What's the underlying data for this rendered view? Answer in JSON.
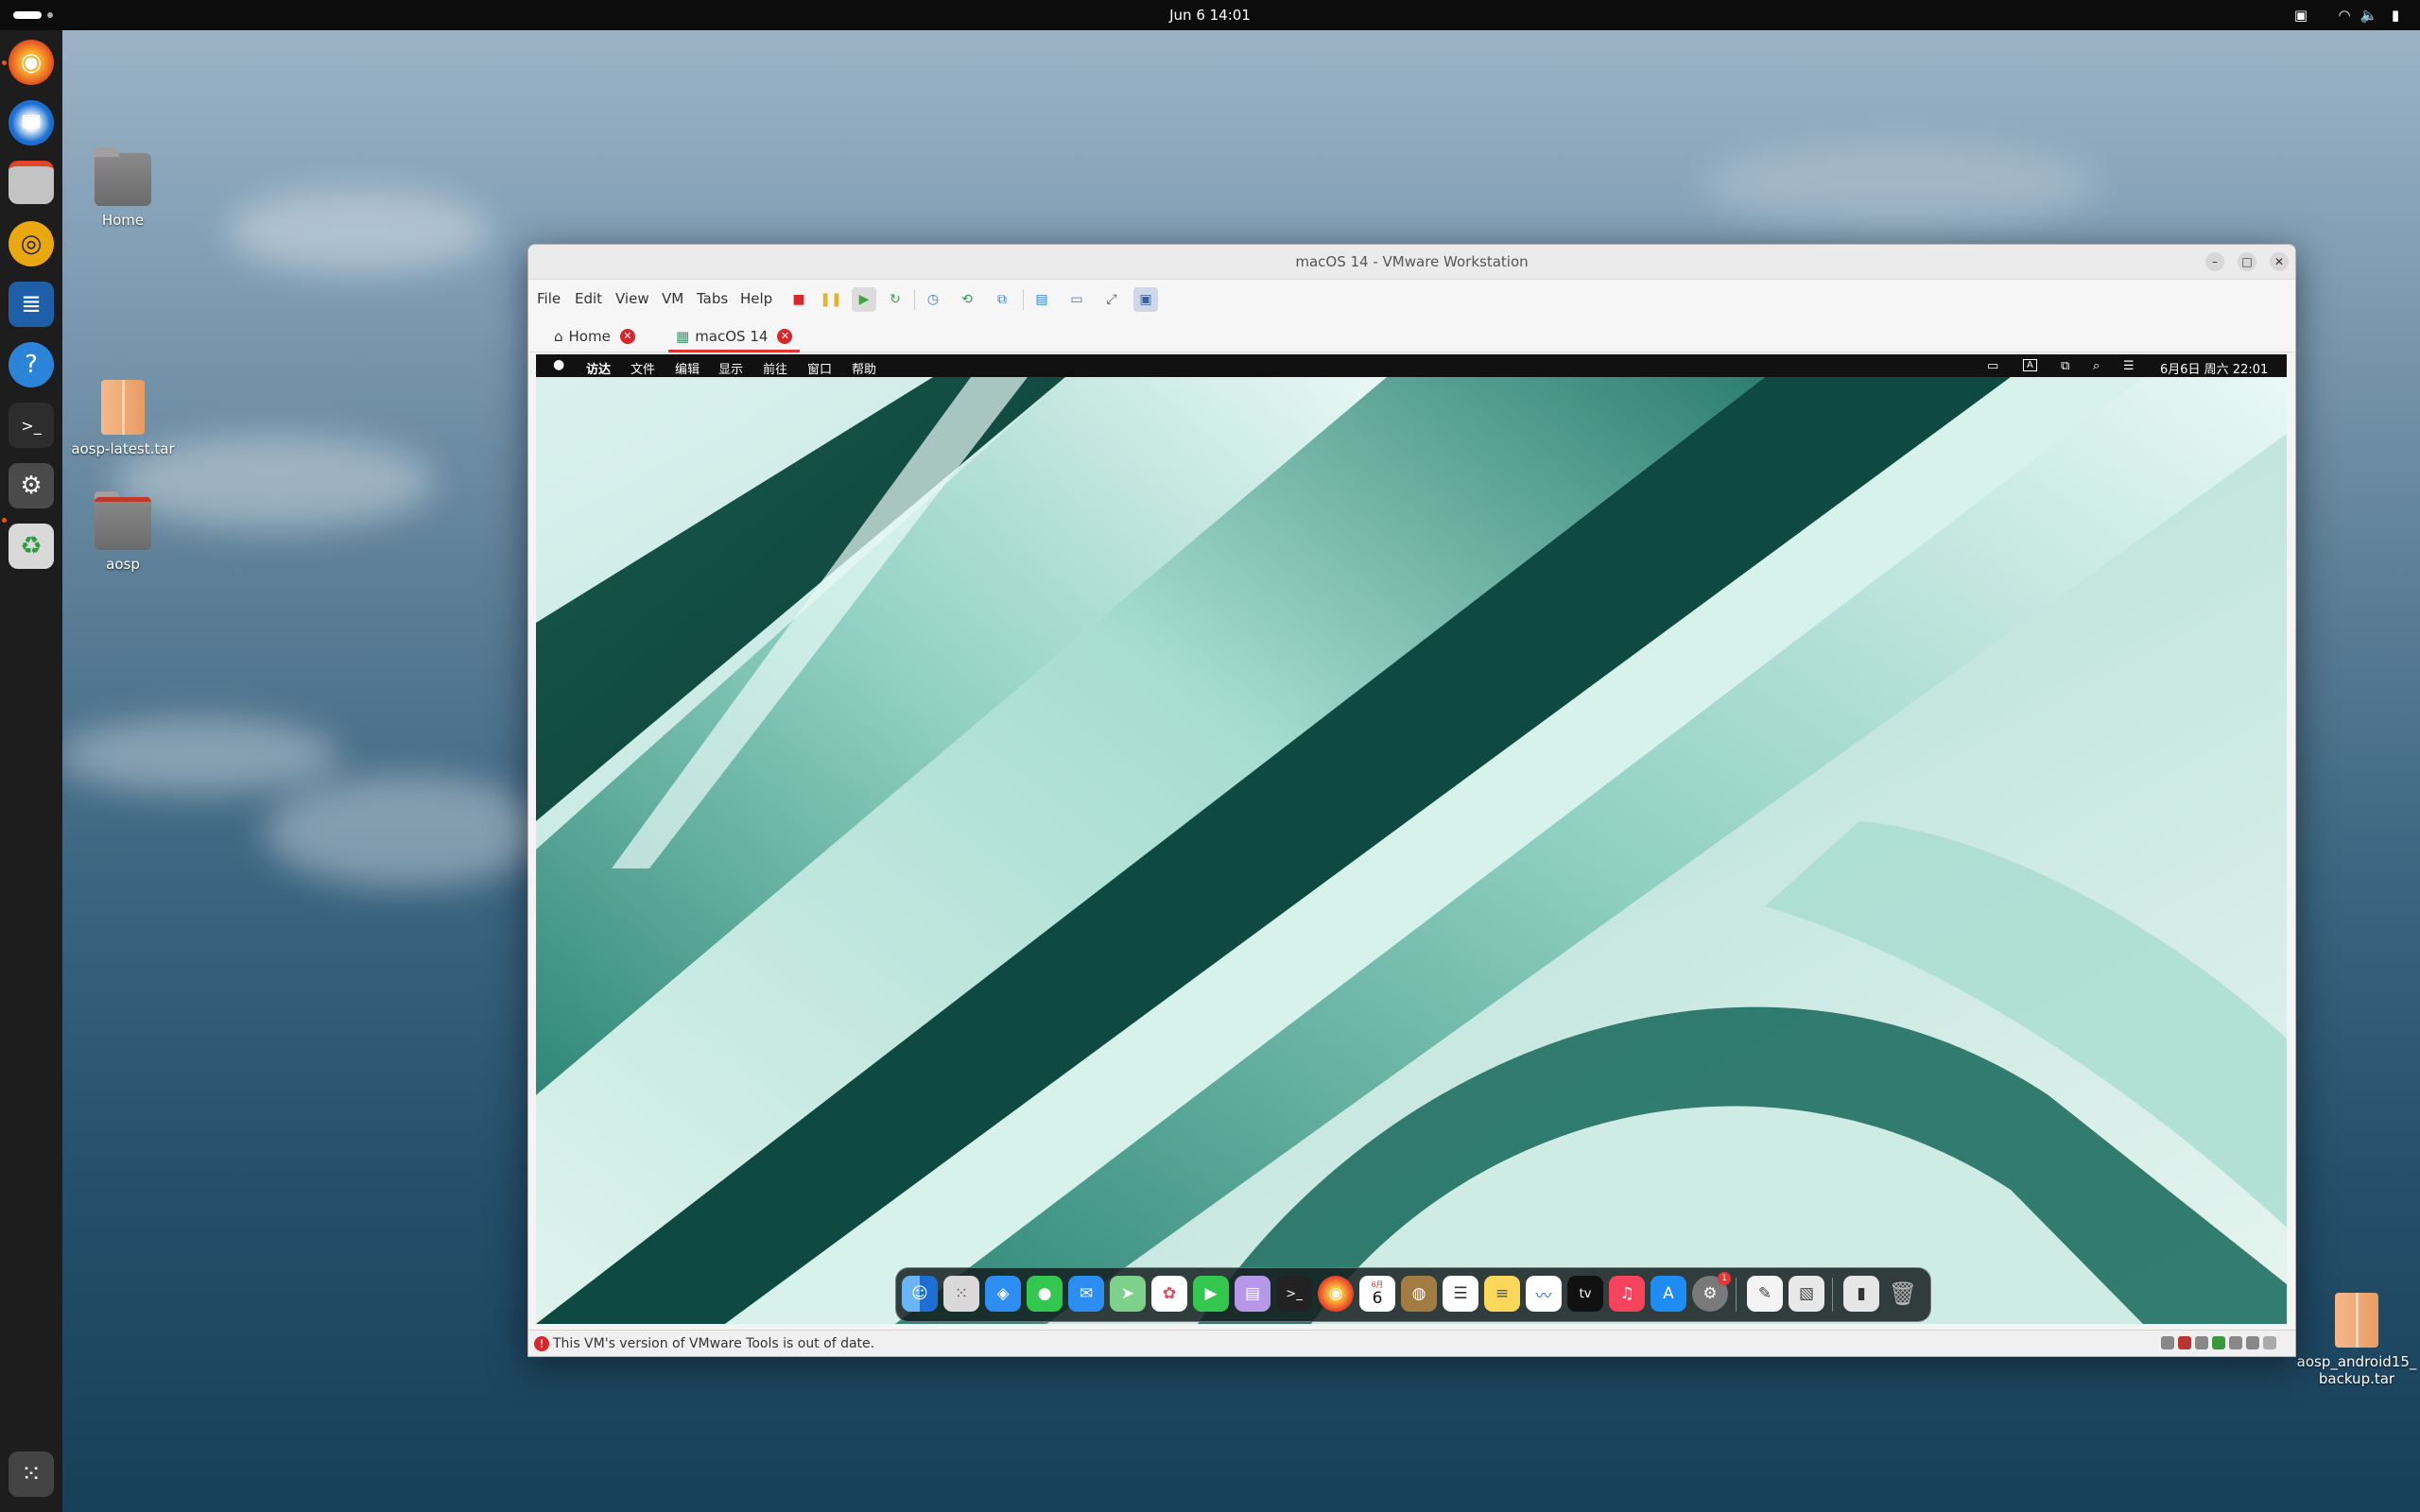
{
  "topbar": {
    "clock": "Jun 6  14:01"
  },
  "desktop_icons": [
    {
      "label": "Home"
    },
    {
      "label": "aosp-latest.tar"
    },
    {
      "label": "aosp"
    },
    {
      "label": "aosp_android15_\nbackup.tar"
    }
  ],
  "dock": {
    "apps": [
      "firefox-icon",
      "thunderbird-icon",
      "files-icon",
      "rhythmbox-icon",
      "writer-icon",
      "help-icon",
      "terminal-icon",
      "settings-icon",
      "trash-icon"
    ],
    "show_apps_icon": "grid-icon"
  },
  "vmware": {
    "title": "macOS 14 - VMware Workstation",
    "menu": [
      "File",
      "Edit",
      "View",
      "VM",
      "Tabs",
      "Help"
    ],
    "tabs": [
      {
        "label": "Home"
      },
      {
        "label": "macOS 14"
      }
    ],
    "status_message": "This VM's version of VMware Tools is out of date."
  },
  "guest": {
    "apple_logo": "",
    "menus": [
      "访达",
      "文件",
      "编辑",
      "显示",
      "前往",
      "窗口",
      "帮助"
    ],
    "clock": "6月6日 周六  22:01",
    "calendar_day": "6",
    "calendar_month": "6月",
    "tv_label": "tv",
    "settings_badge": "1"
  }
}
